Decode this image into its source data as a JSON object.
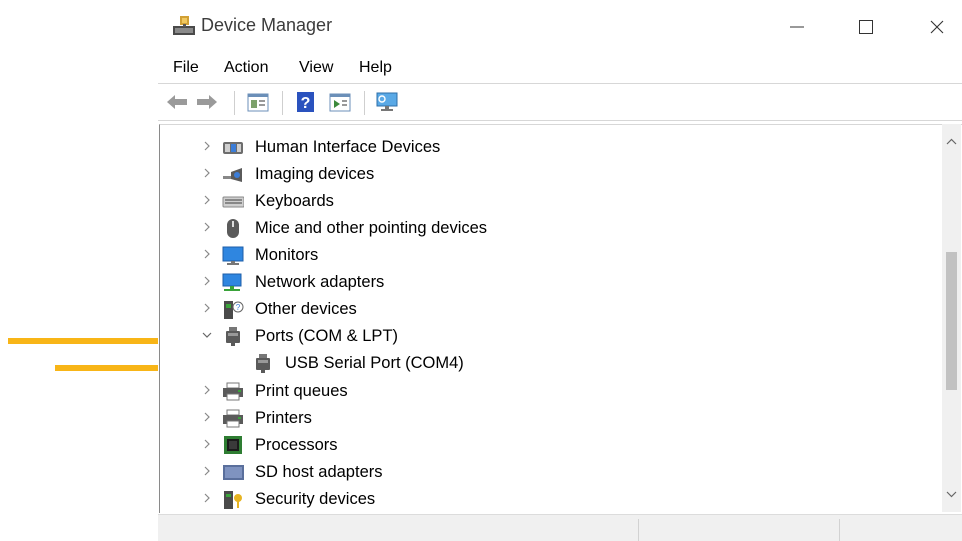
{
  "window": {
    "title": "Device Manager",
    "controls": {
      "minimize": "—",
      "maximize": "☐",
      "close": "✕"
    }
  },
  "menu": [
    "File",
    "Action",
    "View",
    "Help"
  ],
  "toolbar": {
    "buttons": [
      "back-icon",
      "forward-icon",
      "properties-icon",
      "help-icon",
      "update-driver-icon",
      "scan-hardware-icon"
    ]
  },
  "tree": {
    "items": [
      {
        "label": "Human Interface Devices",
        "icon": "hid-icon",
        "expanded": false
      },
      {
        "label": "Imaging devices",
        "icon": "camera-icon",
        "expanded": false
      },
      {
        "label": "Keyboards",
        "icon": "keyboard-icon",
        "expanded": false
      },
      {
        "label": "Mice and other pointing devices",
        "icon": "mouse-icon",
        "expanded": false
      },
      {
        "label": "Monitors",
        "icon": "monitor-icon",
        "expanded": false
      },
      {
        "label": "Network adapters",
        "icon": "network-icon",
        "expanded": false
      },
      {
        "label": "Other devices",
        "icon": "unknown-device-icon",
        "expanded": false
      },
      {
        "label": "Ports (COM & LPT)",
        "icon": "port-icon",
        "expanded": true
      },
      {
        "label": "USB Serial Port (COM4)",
        "icon": "port-icon",
        "child": true
      },
      {
        "label": "Print queues",
        "icon": "printer-icon",
        "expanded": false
      },
      {
        "label": "Printers",
        "icon": "printer-icon",
        "expanded": false
      },
      {
        "label": "Processors",
        "icon": "processor-icon",
        "expanded": false
      },
      {
        "label": "SD host adapters",
        "icon": "sd-card-icon",
        "expanded": false
      },
      {
        "label": "Security devices",
        "icon": "security-icon",
        "expanded": false
      }
    ]
  },
  "annotations": {
    "arrow_color": "#f8b517"
  },
  "colors": {
    "accent_blue": "#1e78d6",
    "scroll_thumb": "#c2c2c2"
  }
}
